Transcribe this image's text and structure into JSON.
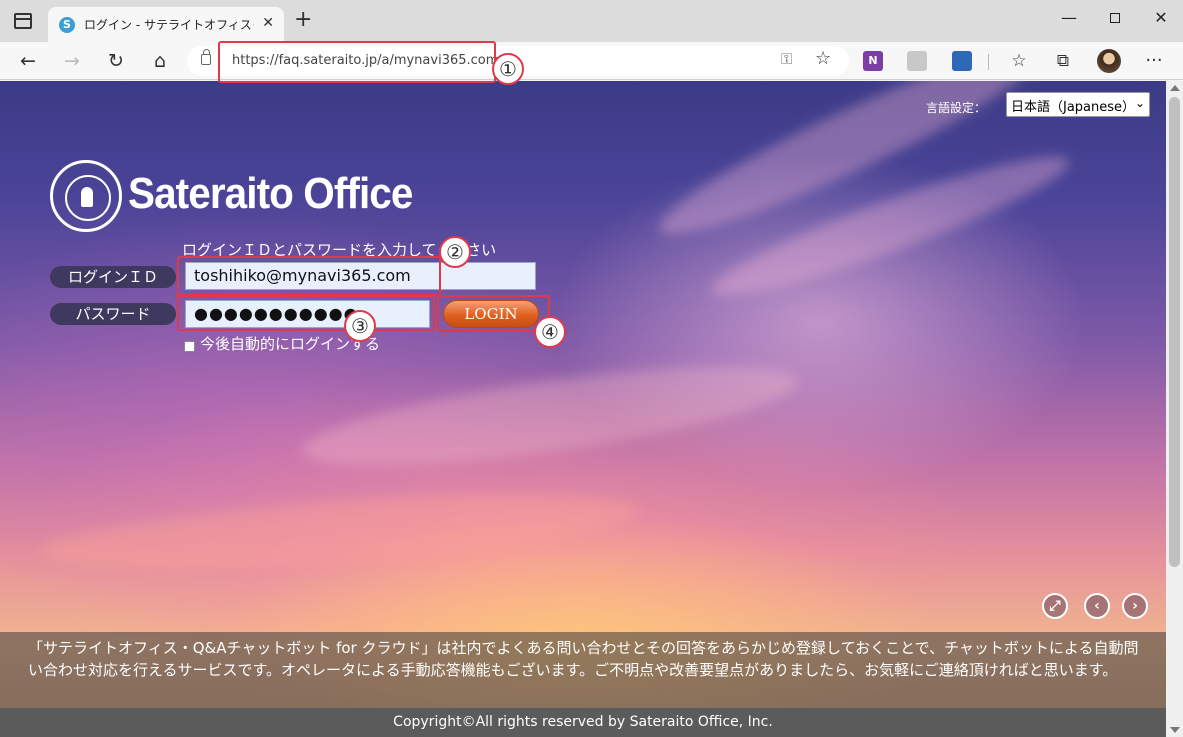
{
  "browser": {
    "tab_title": "ログイン - サテライトオフィス･Q&Aチャ",
    "tab_favicon": "S",
    "tab_close": "✕",
    "newtab": "+",
    "url": "https://faq.sateraito.jp/a/mynavi365.com",
    "minimize": "—",
    "close": "✕",
    "onenote_label": "N",
    "more_label": "···"
  },
  "login_page": {
    "language_label": "言語設定：",
    "language_selected": "日本語（Japanese）",
    "logo_text": "Sateraito Office",
    "instruction": "ログインＩＤとパスワードを入力してください",
    "login_id_label": "ログインＩＤ",
    "password_label": "パスワード",
    "login_id_value": "toshihiko@mynavi365.com",
    "password_value": "●●●●●●●●●●●",
    "login_button": "LOGIN",
    "auto_login_label": "今後自動的にログインする",
    "description": "「サテライトオフィス・Q&Aチャットボット for クラウド」は社内でよくある問い合わせとその回答をあらかじめ登録しておくことで、チャットボットによる自動問い合わせ対応を行えるサービスです。オペレータによる手動応答機能もございます。ご不明点や改善要望点がありましたら、お気軽にご連絡頂ければと思います。",
    "footer": "Copyright©All rights reserved by Sateraito Office, Inc."
  },
  "annotations": {
    "n1": "①",
    "n2": "②",
    "n3": "③",
    "n4": "④",
    "color": "#e03a4a"
  },
  "icons": [
    "sidebar-icon",
    "back-icon",
    "forward-icon",
    "refresh-icon",
    "home-icon",
    "lock-icon",
    "key-icon",
    "add-favorite-icon",
    "onenote-icon",
    "extension-icon",
    "favorites-icon",
    "collections-icon",
    "more-icon",
    "fullscreen-icon",
    "prev-icon",
    "next-icon"
  ]
}
